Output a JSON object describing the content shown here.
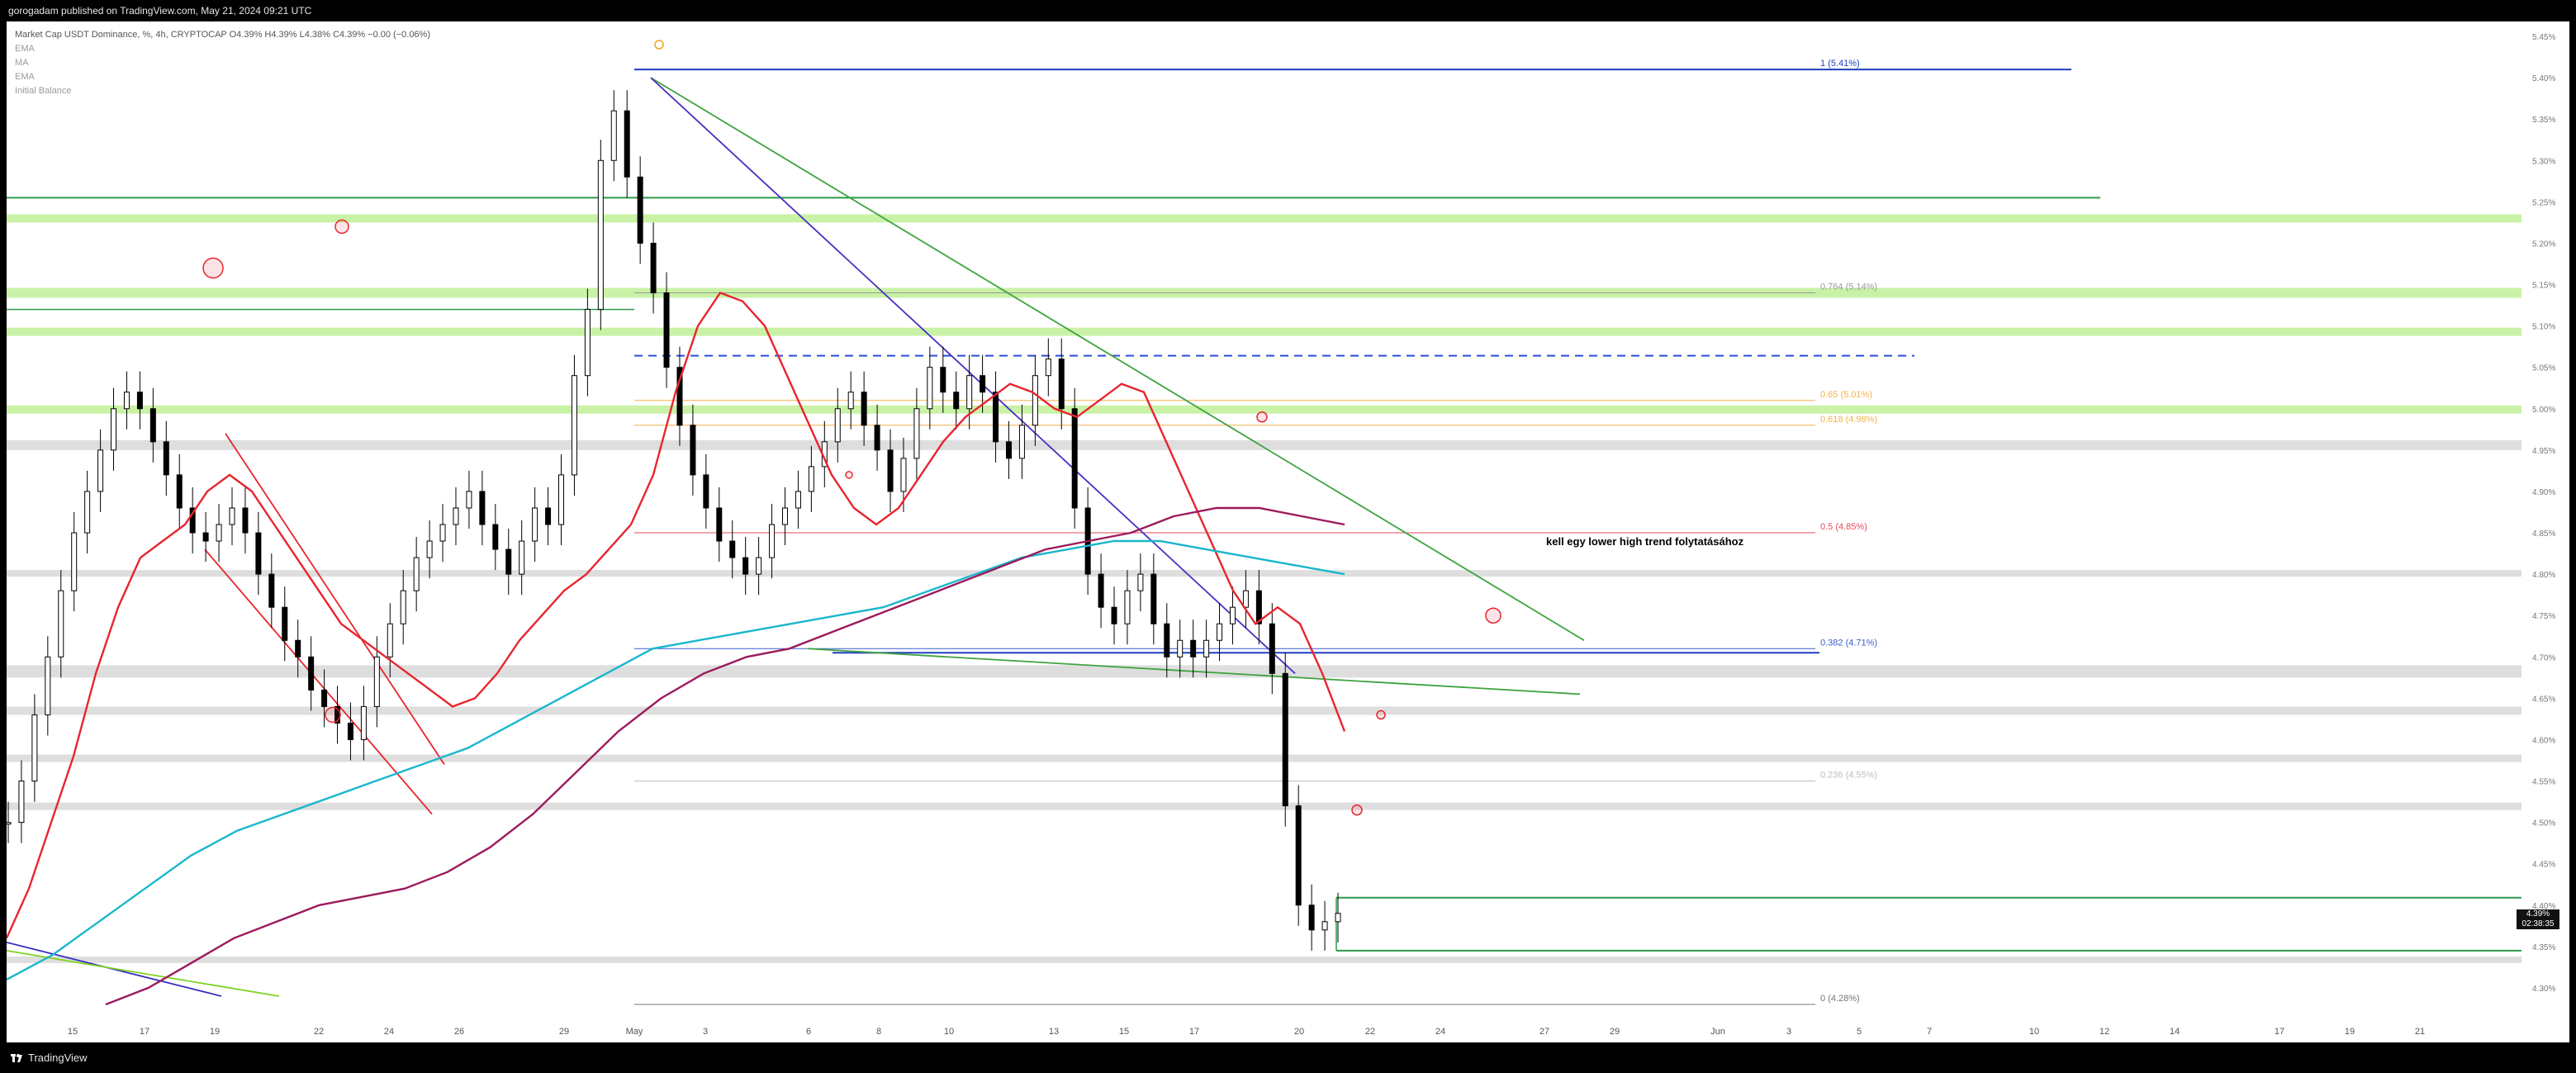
{
  "header": {
    "publisher_line": "gorogadam published on TradingView.com, May 21, 2024 09:21 UTC"
  },
  "legend": {
    "title_line": "Market Cap USDT Dominance, %, 4h, CRYPTOCAP  O4.39%  H4.39%  L4.38%  C4.39%  −0.00 (−0.06%)",
    "indicators": [
      "EMA",
      "MA",
      "EMA",
      "Initial Balance"
    ]
  },
  "fib_labels": [
    "1 (5.41%)",
    "0.764 (5.14%)",
    "0.65 (5.01%)",
    "0.618 (4.98%)",
    "0.5 (4.85%)",
    "0.382 (4.71%)",
    "0.236 (4.55%)",
    "0 (4.28%)"
  ],
  "annotation": "kell egy lower high trend folytatásához",
  "price_tag": {
    "value": "4.39%",
    "countdown": "02:38:35"
  },
  "footer": {
    "brand": "TradingView"
  },
  "colors": {
    "candle": "#000000",
    "ema_fast": "#e8252f",
    "ema_slow": "#9c1a5c",
    "ma": "#19b7cc",
    "trend_green": "#3fa33f",
    "trend_blue": "#1d3fbf",
    "zone_green": "#c9f2a7",
    "zone_gray": "#dedede"
  },
  "chart_data": {
    "type": "candlestick",
    "symbol": "USDT.D",
    "interval": "4h",
    "unit": "%",
    "ylim": [
      4.27,
      5.46
    ],
    "y_ticks": [
      4.3,
      4.35,
      4.4,
      4.45,
      4.5,
      4.55,
      4.6,
      4.65,
      4.7,
      4.75,
      4.8,
      4.85,
      4.9,
      4.95,
      5.0,
      5.05,
      5.1,
      5.15,
      5.2,
      5.25,
      5.3,
      5.35,
      5.4,
      5.45
    ],
    "x_tick_labels": [
      "15",
      "17",
      "19",
      "22",
      "24",
      "26",
      "29",
      "May",
      "3",
      "6",
      "8",
      "10",
      "13",
      "15",
      "17",
      "20",
      "22",
      "24",
      "27",
      "29",
      "Jun",
      "3",
      "5",
      "7",
      "10",
      "12",
      "14",
      "17",
      "19",
      "21"
    ],
    "x_label_index": [
      0,
      1,
      2,
      3,
      4,
      5,
      6,
      7,
      8,
      9,
      10,
      11,
      12,
      13,
      14,
      15,
      16,
      17,
      18,
      19,
      20,
      21,
      22,
      23,
      24,
      25,
      26,
      27,
      28,
      29
    ],
    "close": [
      4.5,
      4.55,
      4.63,
      4.7,
      4.78,
      4.85,
      4.9,
      4.95,
      5.0,
      5.02,
      5.0,
      4.96,
      4.92,
      4.88,
      4.85,
      4.84,
      4.86,
      4.88,
      4.85,
      4.8,
      4.76,
      4.72,
      4.7,
      4.66,
      4.64,
      4.62,
      4.6,
      4.64,
      4.7,
      4.74,
      4.78,
      4.82,
      4.84,
      4.86,
      4.88,
      4.9,
      4.86,
      4.83,
      4.8,
      4.84,
      4.88,
      4.86,
      4.92,
      5.04,
      5.12,
      5.3,
      5.36,
      5.28,
      5.2,
      5.14,
      5.05,
      4.98,
      4.92,
      4.88,
      4.84,
      4.82,
      4.8,
      4.82,
      4.86,
      4.88,
      4.9,
      4.93,
      4.96,
      5.0,
      5.02,
      4.98,
      4.95,
      4.9,
      4.94,
      5.0,
      5.05,
      5.02,
      5.0,
      5.04,
      5.02,
      4.96,
      4.94,
      4.98,
      5.04,
      5.06,
      5.0,
      4.88,
      4.8,
      4.76,
      4.74,
      4.78,
      4.8,
      4.74,
      4.7,
      4.72,
      4.7,
      4.72,
      4.74,
      4.76,
      4.78,
      4.74,
      4.68,
      4.52,
      4.4,
      4.37,
      4.38,
      4.39
    ],
    "series": [
      {
        "name": "EMA",
        "values": [
          4.36,
          4.42,
          4.5,
          4.58,
          4.68,
          4.76,
          4.82,
          4.84,
          4.86,
          4.9,
          4.92,
          4.9,
          4.86,
          4.82,
          4.78,
          4.74,
          4.72,
          4.7,
          4.68,
          4.66,
          4.64,
          4.65,
          4.68,
          4.72,
          4.75,
          4.78,
          4.8,
          4.83,
          4.86,
          4.92,
          5.02,
          5.1,
          5.14,
          5.13,
          5.1,
          5.04,
          4.98,
          4.92,
          4.88,
          4.86,
          4.88,
          4.92,
          4.96,
          4.99,
          5.01,
          5.03,
          5.02,
          5.0,
          4.99,
          5.01,
          5.03,
          5.02,
          4.96,
          4.9,
          4.84,
          4.78,
          4.74,
          4.76,
          4.74,
          4.68,
          4.61
        ]
      },
      {
        "name": "MA",
        "values": [
          4.31,
          4.34,
          4.38,
          4.42,
          4.46,
          4.49,
          4.51,
          4.53,
          4.55,
          4.57,
          4.59,
          4.62,
          4.65,
          4.68,
          4.71,
          4.72,
          4.73,
          4.74,
          4.75,
          4.76,
          4.78,
          4.8,
          4.82,
          4.83,
          4.84,
          4.84,
          4.83,
          4.82,
          4.81,
          4.8
        ]
      },
      {
        "name": "EMA",
        "values": [
          4.28,
          4.3,
          4.33,
          4.36,
          4.38,
          4.4,
          4.41,
          4.42,
          4.44,
          4.47,
          4.51,
          4.56,
          4.61,
          4.65,
          4.68,
          4.7,
          4.71,
          4.73,
          4.75,
          4.77,
          4.79,
          4.81,
          4.83,
          4.84,
          4.85,
          4.87,
          4.88,
          4.88,
          4.87,
          4.86
        ]
      }
    ]
  }
}
